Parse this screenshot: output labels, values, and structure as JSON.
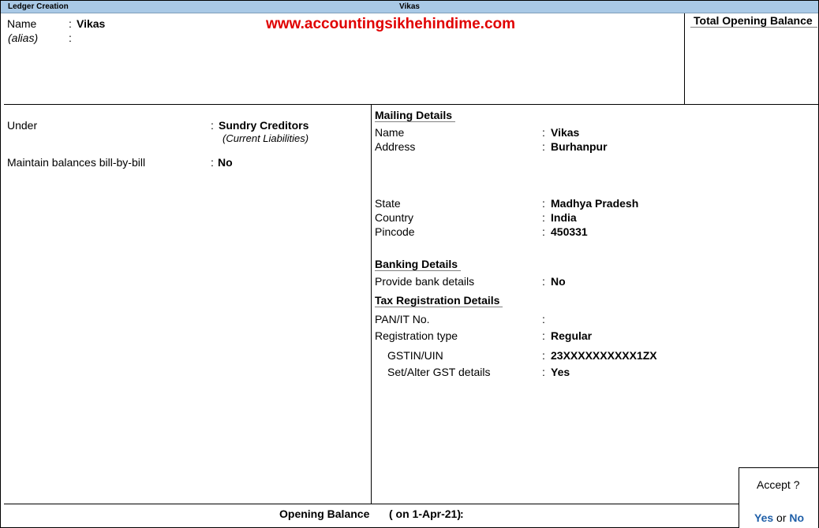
{
  "titlebar": {
    "screen": "Ledger Creation",
    "ledger": "Vikas"
  },
  "watermark": "www.accountingsikhehindime.com",
  "header": {
    "name_label": "Name",
    "name_colon": ":",
    "name_value": "Vikas",
    "alias_label": "(alias)",
    "alias_colon": ":",
    "total_opening_label": "Total Opening Balance"
  },
  "left": {
    "under_label": "Under",
    "under_colon": ":",
    "under_value": "Sundry Creditors",
    "under_group": "(Current Liabilities)",
    "billbybill_label": "Maintain balances bill-by-bill",
    "billbybill_colon": ":",
    "billbybill_value": "No"
  },
  "mailing": {
    "title": "Mailing Details",
    "name_label": "Name",
    "name_colon": ":",
    "name_value": "Vikas",
    "address_label": "Address",
    "address_colon": ":",
    "address_value": "Burhanpur",
    "state_label": "State",
    "state_colon": ":",
    "state_value": "Madhya Pradesh",
    "country_label": "Country",
    "country_colon": ":",
    "country_value": "India",
    "pincode_label": "Pincode",
    "pincode_colon": ":",
    "pincode_value": "450331"
  },
  "banking": {
    "title": "Banking Details",
    "provide_label": "Provide bank details",
    "provide_colon": ":",
    "provide_value": "No"
  },
  "tax": {
    "title": "Tax Registration Details",
    "pan_label": "PAN/IT No.",
    "pan_colon": ":",
    "regtype_label": "Registration type",
    "regtype_colon": ":",
    "regtype_value": "Regular",
    "gstin_label": "GSTIN/UIN",
    "gstin_colon": ":",
    "gstin_value": "23XXXXXXXXXX1ZX",
    "gstdetails_label": "Set/Alter GST details",
    "gstdetails_colon": ":",
    "gstdetails_value": "Yes"
  },
  "footer": {
    "opening_label": "Opening Balance",
    "opening_date": "( on 1-Apr-21)",
    "opening_colon": ":"
  },
  "accept": {
    "question": "Accept ?",
    "yes": "Yes",
    "or": "or",
    "no": "No"
  }
}
